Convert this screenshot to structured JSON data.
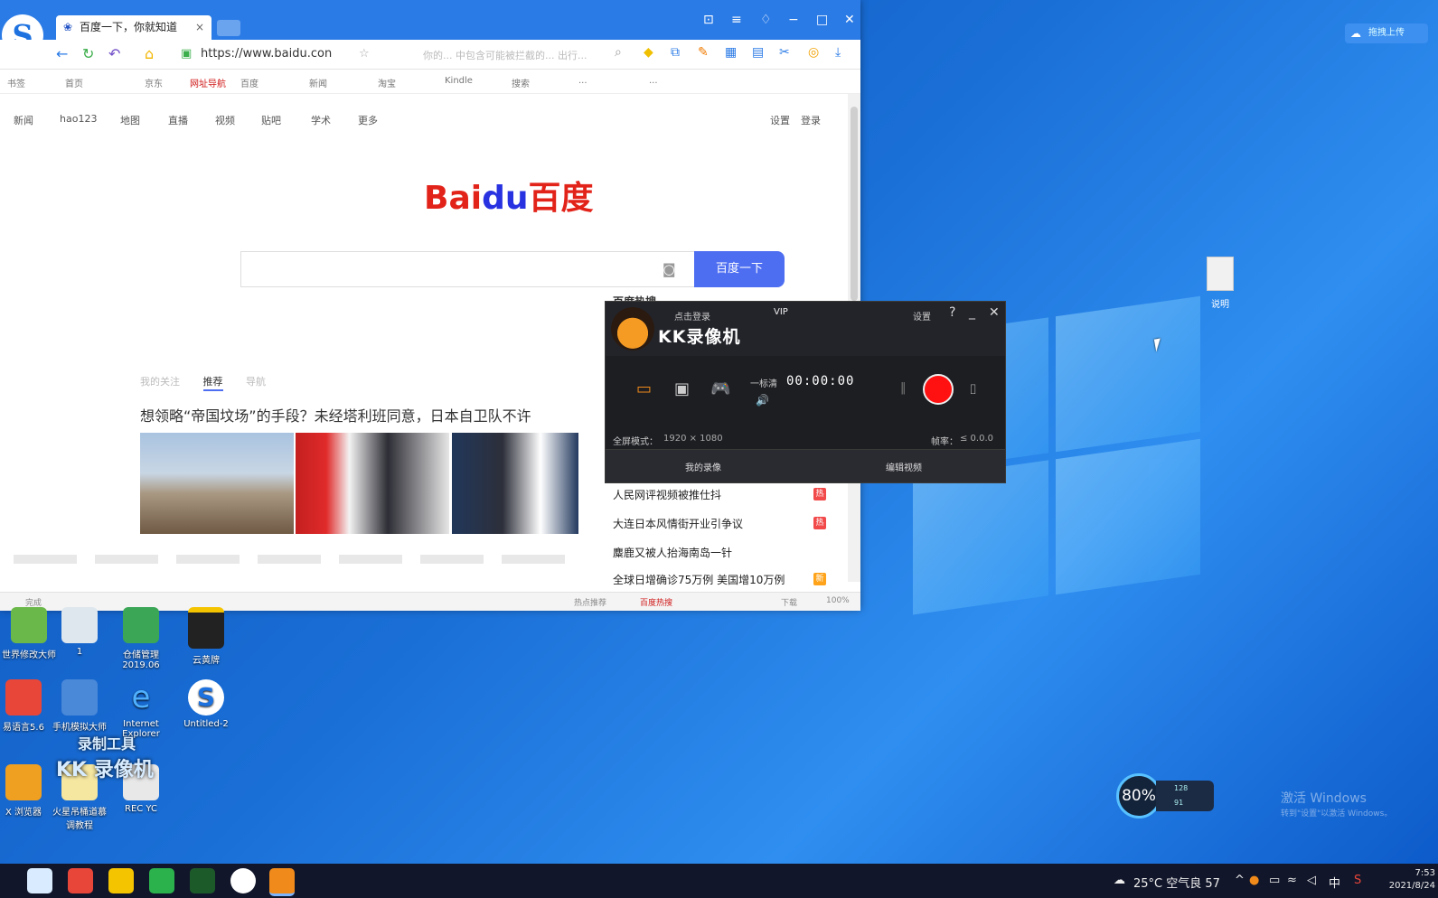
{
  "browser": {
    "tab_title": "百度一下，你就知道",
    "tab_close": "×",
    "url": "https://www.baidu.con",
    "url_hint": "你的... 中包含可能被拦截的... 出行...",
    "bookmarks": [
      "书签",
      "首页",
      "京东",
      "网址导航",
      "百度",
      "新闻",
      "淘宝",
      "Kindle",
      "搜索",
      "...",
      "..."
    ],
    "top_nav": [
      "新闻",
      "hao123",
      "地图",
      "直播",
      "视频",
      "贴吧",
      "学术",
      "更多"
    ],
    "settings_label": "设置",
    "login_label": "登录"
  },
  "baidu": {
    "logo_bai": "Bai",
    "logo_du": "du",
    "logo_cn": "百度",
    "search_button": "百度一下",
    "feed_tabs": [
      "我的关注",
      "推荐",
      "导航"
    ],
    "headline": "想领略“帝国坟场”的手段？未经塔利班同意，日本自卫队不许",
    "hot_title": "百度热搜",
    "hot_items": [
      {
        "text": "人民网评视频被推仕抖",
        "badge": "热"
      },
      {
        "text": "大连日本风情街开业引争议",
        "badge": "热"
      },
      {
        "text": "麋鹿又被人抬海南岛一针",
        "badge": ""
      },
      {
        "text": "全球日增确诊75万例 美国增10万例",
        "badge": "新"
      }
    ]
  },
  "statusbar": {
    "left": "完成",
    "items": [
      "热点推荐",
      "百度热搜",
      "下载",
      "100%"
    ]
  },
  "kk": {
    "login": "点击登录",
    "vip": "VIP",
    "settings": "设置",
    "help": "?",
    "minimize": "_",
    "close": "✕",
    "title": "KK录像机",
    "quality": "一标清",
    "timer": "00:00:00",
    "mode_label": "全屏模式：",
    "resolution": "1920 × 1080",
    "fps_label": "帧率：",
    "fps": "≤ 0.0.0",
    "my_recordings": "我的录像",
    "edit_video": "编辑视频"
  },
  "desktop": {
    "upload_button": "拖拽上传",
    "file_label": "说明",
    "icons": [
      {
        "label": "世界修改大师"
      },
      {
        "label": "1"
      },
      {
        "label": "仓储管理 2019.06"
      },
      {
        "label": "云黄牌"
      },
      {
        "label": "易语言5.6"
      },
      {
        "label": "手机模拟大师"
      },
      {
        "label": "Internet Explorer"
      },
      {
        "label": "Untitled-2"
      },
      {
        "label": "X 浏览器"
      },
      {
        "label": "火星吊桶道慕 调教程"
      },
      {
        "label": "REC YC"
      }
    ],
    "watermark_line1": "录制工具",
    "watermark_line2": "KK 录像机",
    "gauge_value": "80%",
    "gauge_side_top": "128",
    "gauge_side_bottom": "91",
    "activate_title": "激活 Windows",
    "activate_sub": "转到\"设置\"以激活 Windows。"
  },
  "taskbar": {
    "weather": "25°C 空气良 57",
    "ime": "中",
    "time": "7:53",
    "date": "2021/8/24"
  }
}
